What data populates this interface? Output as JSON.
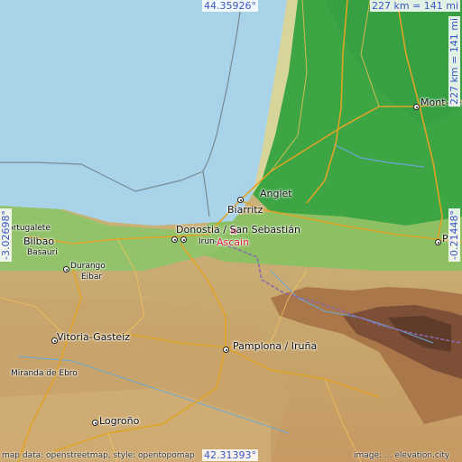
{
  "map": {
    "place": "Ascain",
    "colors": {
      "sea": "#a9d3e8",
      "lowland": "#4fae46",
      "hills": "#c9b57d",
      "mountains": "#8a5a3a",
      "roads": "#e0a326",
      "marker": "#e02040",
      "coord_text": "#3b57c8"
    },
    "coords": {
      "top": "44.35926°",
      "bottom": "42.31393°",
      "left": "-3.02698°",
      "right": "-0.21448°",
      "scale_h": "227 km = 141 mi",
      "scale_v": "227 km = 141 mi"
    },
    "cities": {
      "mont_de_marsan": "Mont-de-M",
      "anglet": "Anglet",
      "biarritz": "Biarritz",
      "donostia": "Donostia / San Sebastián",
      "irun": "Irun",
      "ascain": "Ascain",
      "portugalete": "Portugalete",
      "bilbao": "Bilbao",
      "basauri": "Basauri",
      "durango": "Durango",
      "eibar": "Eibar",
      "pau": "Pa",
      "vitoria": "Vitoria-Gasteiz",
      "pamplona": "Pamplona / Iruña",
      "miranda": "Miranda de Ebro",
      "logrono": "Logroño"
    },
    "credit_left": "map data: openstreetmap, style: opentopomap",
    "credit_right": "image: ... elevation.city"
  }
}
